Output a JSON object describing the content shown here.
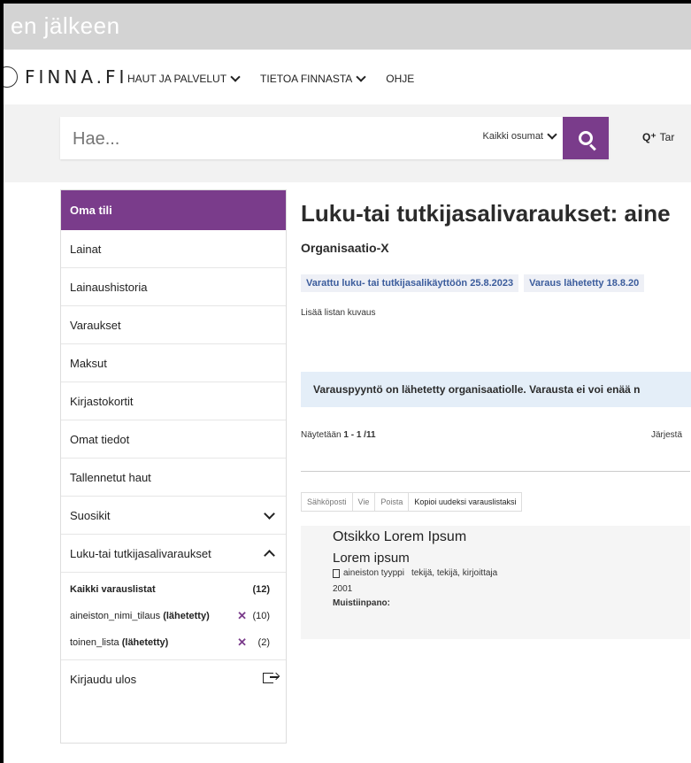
{
  "window": {
    "title": "en jälkeen"
  },
  "brand": {
    "logo_text": "FINNA.FI"
  },
  "nav": {
    "items": [
      {
        "label": "HAUT JA PALVELUT"
      },
      {
        "label": "TIETOA FINNASTA"
      },
      {
        "label": "OHJE"
      }
    ]
  },
  "search": {
    "placeholder": "Hae...",
    "scope": "Kaikki osumat",
    "advanced_label": "Tar"
  },
  "sidebar": {
    "header": "Oma tili",
    "items": [
      {
        "label": "Lainat"
      },
      {
        "label": "Lainaushistoria"
      },
      {
        "label": "Varaukset"
      },
      {
        "label": "Maksut"
      },
      {
        "label": "Kirjastokortit"
      },
      {
        "label": "Omat tiedot"
      },
      {
        "label": "Tallennetut haut"
      },
      {
        "label": "Suosikit"
      },
      {
        "label": "Luku-tai tutkijasalivaraukset"
      }
    ],
    "reservation_lists": [
      {
        "name": "Kaikki varauslistat",
        "status": "",
        "count": "(12)"
      },
      {
        "name": "aineiston_nimi_tilaus",
        "status": "(lähetetty)",
        "count": "(10)"
      },
      {
        "name": "toinen_lista",
        "status": "(lähetetty)",
        "count": "(2)"
      }
    ],
    "logout": "Kirjaudu ulos"
  },
  "main": {
    "title": "Luku-tai tutkijasalivaraukset: aine",
    "organisation": "Organisaatio-X",
    "badges": [
      {
        "label": "Varattu luku- tai tutkijasalikäyttöön 25.8.2023"
      },
      {
        "label": "Varaus lähetetty 18.8.20"
      }
    ],
    "description": "Lisää listan kuvaus",
    "info": "Varauspyyntö on lähetetty organisaatiolle. Varausta ei voi enää n",
    "results_prefix": "Näytetään ",
    "results_range": "1 - 1 /11",
    "sort_label": "Järjestä",
    "actions": [
      {
        "label": "Sähköposti"
      },
      {
        "label": "Vie"
      },
      {
        "label": "Poista"
      },
      {
        "label": "Kopioi uudeksi varauslistaksi"
      }
    ],
    "record": {
      "title": "Otsikko Lorem Ipsum",
      "subtitle": "Lorem ipsum",
      "format": "aineiston tyyppi",
      "authors": "tekijä, tekijä, kirjoittaja",
      "year": "2001",
      "note_label": "Muistiinpano:"
    }
  },
  "colors": {
    "accent": "#7a3c8b",
    "info_bg": "#e4eef8",
    "badge_text": "#3b5c9c"
  }
}
